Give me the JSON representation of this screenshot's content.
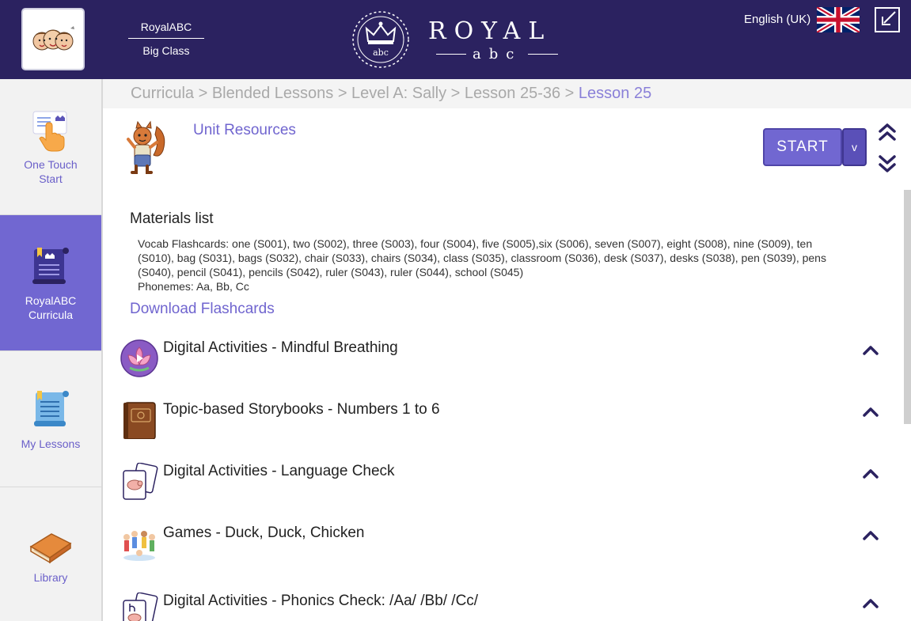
{
  "header": {
    "school_name": "RoyalABC",
    "class_name": "Big Class",
    "logo_word": "ROYAL",
    "logo_sub": "abc",
    "logo_badge": "abc",
    "language": "English (UK)",
    "icons": {
      "avatar": "kids-avatar-icon",
      "logo": "crown-wreath-logo",
      "flag": "uk-flag-icon",
      "exit": "exit-fullscreen-icon"
    },
    "colors": {
      "bar": "#2b2260",
      "accent": "#7167d1"
    }
  },
  "sidebar": {
    "items": [
      {
        "label": "One Touch Start",
        "icon": "hand-pointer-icon",
        "active": false
      },
      {
        "label": "RoyalABC Curricula",
        "icon": "scroll-book-icon",
        "active": true
      },
      {
        "label": "My Lessons",
        "icon": "lesson-scroll-icon",
        "active": false
      },
      {
        "label": "Library",
        "icon": "book-icon",
        "active": false
      }
    ]
  },
  "breadcrumb": {
    "trail": "Curricula > Blended Lessons > Level A: Sally > Lesson 25-36 > ",
    "current": "Lesson 25"
  },
  "unit": {
    "title": "Unit Resources",
    "start_label": "START",
    "start_caret": "v"
  },
  "materials": {
    "heading": "Materials list",
    "lines": [
      "Vocab Flashcards: one (S001), two (S002), three (S003), four (S004), five (S005),six (S006), seven (S007), eight (S008), nine (S009), ten",
      "(S010), bag (S031), bags (S032), chair (S033), chairs (S034), class (S035), classroom (S036), desk (S037), desks (S038), pen (S039), pens",
      "(S040), pencil (S041), pencils (S042), ruler (S043), ruler (S044), school (S045)",
      "Phonemes: Aa, Bb, Cc"
    ],
    "download_label": "Download Flashcards"
  },
  "activities": [
    {
      "title": "Digital Activities - Mindful Breathing",
      "icon": "lotus-video-icon"
    },
    {
      "title": "Topic-based Storybooks - Numbers 1 to 6",
      "icon": "storybook-icon"
    },
    {
      "title": "Digital Activities - Language Check",
      "icon": "flashcards-icon"
    },
    {
      "title": "Games - Duck, Duck, Chicken",
      "icon": "children-group-icon"
    },
    {
      "title": "Digital Activities - Phonics Check: /Aa/ /Bb/ /Cc/",
      "icon": "phonics-cards-icon"
    }
  ]
}
